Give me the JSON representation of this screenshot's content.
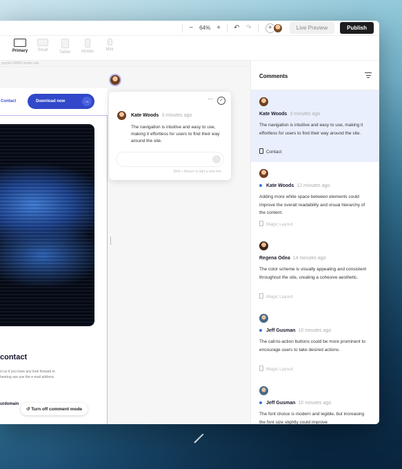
{
  "toolbar": {
    "zoom_minus": "−",
    "zoom_level": "64%",
    "zoom_plus": "+",
    "undo": "↶",
    "redo": "↷",
    "add_collaborator": "+",
    "live_preview_label": "Live Preview",
    "publish_label": "Publish"
  },
  "devices": [
    {
      "label": "Primary"
    },
    {
      "label": "Small"
    },
    {
      "label": "Tablet"
    },
    {
      "label": "Mobile"
    },
    {
      "label": "Mini"
    }
  ],
  "url_text": "purple148983.studio.site",
  "page": {
    "contact_link": "Contact",
    "download_label": "Download now",
    "download_arrow": "→",
    "contact_heading": "contact",
    "contact_body": "ct us if you have any look forward to hearing ase use the e-mail address",
    "domain_text": "urdomain"
  },
  "turn_off_label": "Turn off comment mode",
  "turn_off_icon": "↺",
  "popover": {
    "dots": "···",
    "check": "✓",
    "author": "Kate Woods",
    "time": "3 minutes ago",
    "text": "The navigation is intuitive and easy to use, making it effortless for users to find their way around the site.",
    "send": "↑",
    "hint": "Shift + Return to add a new line"
  },
  "panel": {
    "title": "Comments",
    "items": [
      {
        "author": "Kate Woods",
        "time": "3 minutes ago",
        "text": "The navigation is intuitive and easy to use, making it effortless for users to find their way around the site.",
        "tag": "Contact",
        "unread": false
      },
      {
        "author": "Kate Woods",
        "time": "12 minutes ago",
        "text": "Adding more white space between elements could improve the overall readability and visual hierarchy of the content.",
        "tag": "Magic Layout",
        "unread": true
      },
      {
        "author": "Regena Odea",
        "time": "14 minutes ago",
        "text": "The color scheme is visually appealing and consistent throughout the site, creating a cohesive aesthetic.",
        "tag": "Magic Layout",
        "unread": false
      },
      {
        "author": "Jeff Gusman",
        "time": "10 minutes ago",
        "text": "The call-to-action buttons could be more prominent to encourage users to take desired actions.",
        "tag": "Magic Layout",
        "unread": true
      },
      {
        "author": "Jeff Gusman",
        "time": "10 minutes ago",
        "text": "The font choice is modern and legible, but increasing the font size slightly could improve",
        "tag": "",
        "unread": true
      }
    ]
  },
  "colors": {
    "accent": "#3048c9",
    "selected_bg": "#e9effc",
    "unread_dot": "#3d6fe0",
    "publish_bg": "#1d1d1f"
  }
}
